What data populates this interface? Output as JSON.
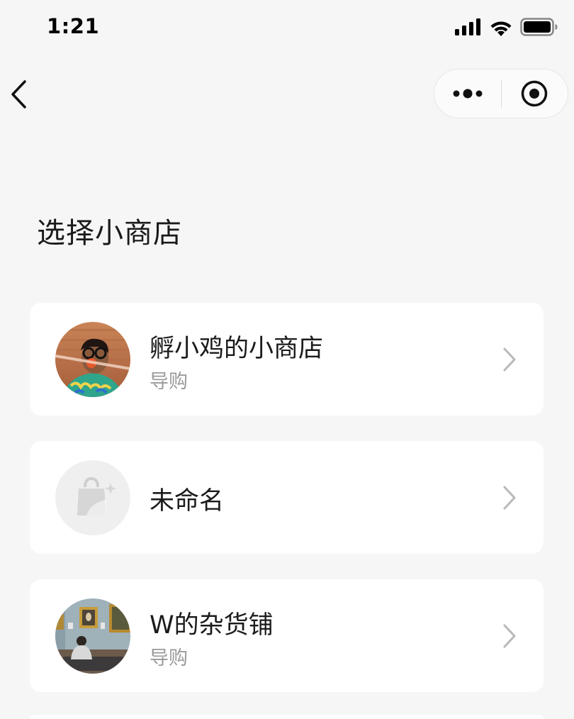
{
  "status_bar": {
    "time": "1:21",
    "icons": [
      "signal-icon",
      "wifi-icon",
      "battery-icon"
    ]
  },
  "nav": {
    "back_icon": "chevron-left-icon",
    "capsule": {
      "more_icon": "more-dots-icon",
      "close_icon": "target-circle-icon"
    }
  },
  "page": {
    "title": "选择小商店"
  },
  "shops": [
    {
      "name": "孵小鸡的小商店",
      "role": "导购",
      "avatar": "photo-avatar-child-with-glasses"
    },
    {
      "name": "未命名",
      "role": "",
      "avatar": "shopping-bag-sparkle-icon"
    },
    {
      "name": "W的杂货铺",
      "role": "导购",
      "avatar": "photo-avatar-museum-gallery"
    }
  ],
  "colors": {
    "background": "#f6f6f6",
    "card": "#ffffff",
    "text_primary": "#1b1b1b",
    "text_secondary": "#9a9a9a",
    "chevron": "#b9b9b9"
  }
}
